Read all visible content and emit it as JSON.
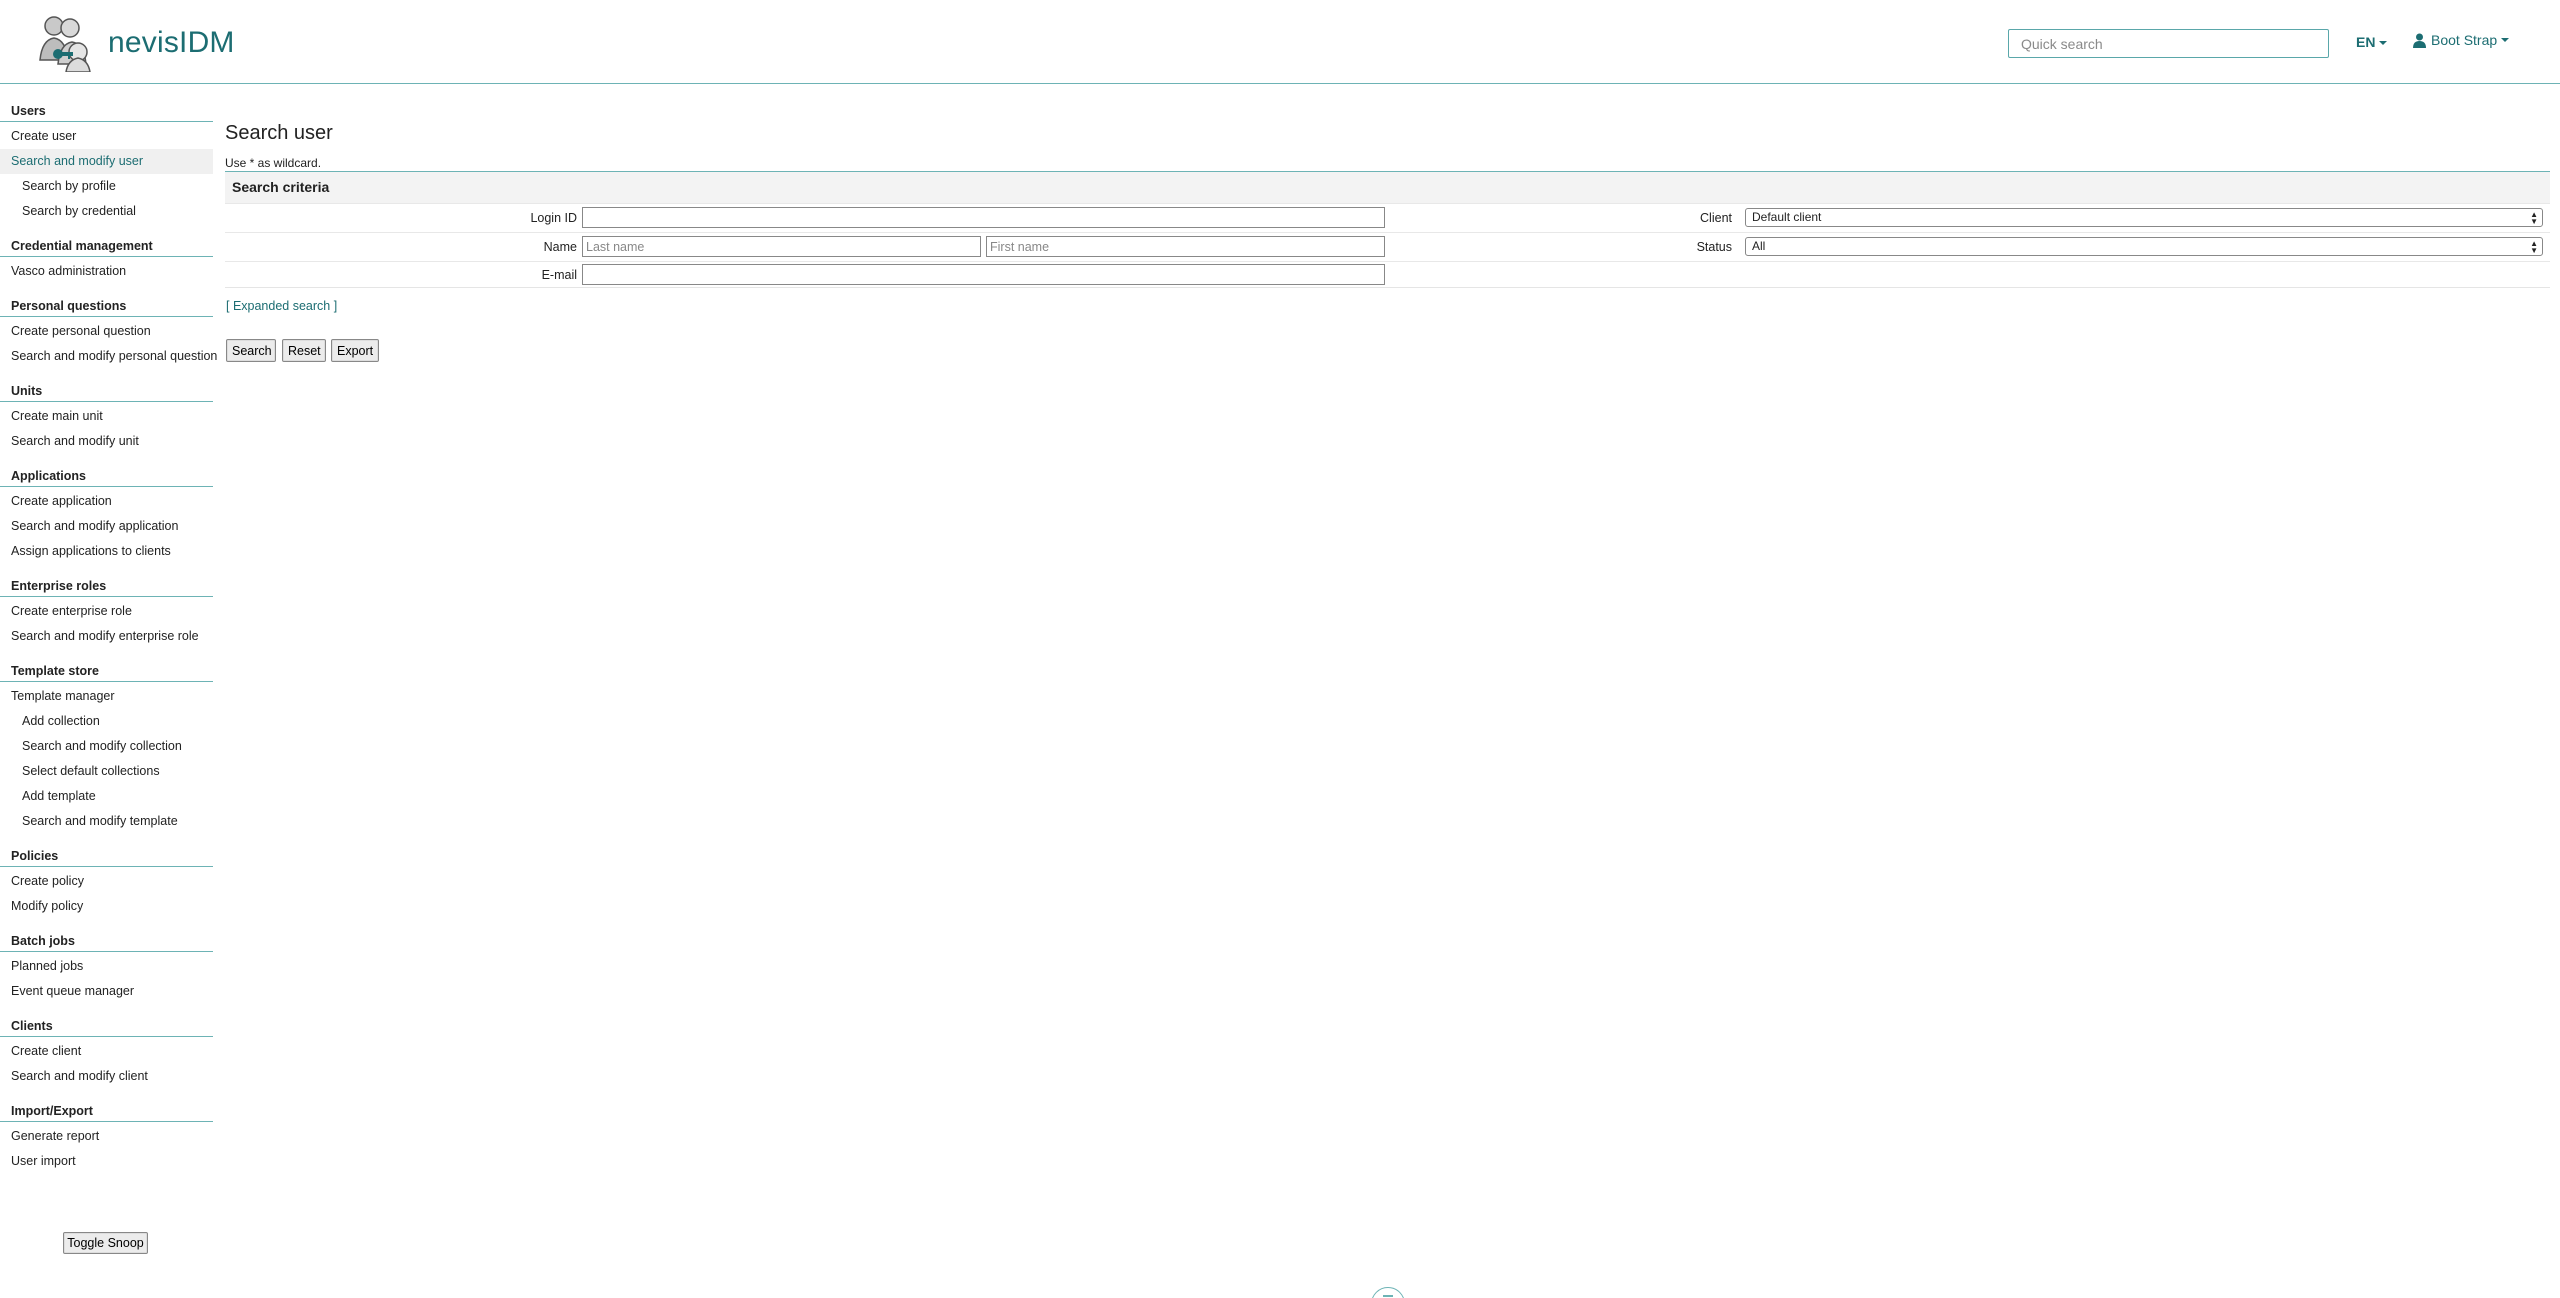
{
  "header": {
    "brand": "nevisIDM",
    "quick_search_placeholder": "Quick search",
    "language": "EN",
    "user_name": "Boot Strap"
  },
  "sidebar": {
    "sections": [
      {
        "title": "Users",
        "items": [
          {
            "label": "Create user"
          },
          {
            "label": "Search and modify user",
            "active": true
          },
          {
            "label": "Search by profile",
            "sub": true
          },
          {
            "label": "Search by credential",
            "sub": true
          }
        ]
      },
      {
        "title": "Credential management",
        "items": [
          {
            "label": "Vasco administration"
          }
        ]
      },
      {
        "title": "Personal questions",
        "items": [
          {
            "label": "Create personal question"
          },
          {
            "label": "Search and modify personal question"
          }
        ]
      },
      {
        "title": "Units",
        "items": [
          {
            "label": "Create main unit"
          },
          {
            "label": "Search and modify unit"
          }
        ]
      },
      {
        "title": "Applications",
        "items": [
          {
            "label": "Create application"
          },
          {
            "label": "Search and modify application"
          },
          {
            "label": "Assign applications to clients"
          }
        ]
      },
      {
        "title": "Enterprise roles",
        "items": [
          {
            "label": "Create enterprise role"
          },
          {
            "label": "Search and modify enterprise role"
          }
        ]
      },
      {
        "title": "Template store",
        "items": [
          {
            "label": "Template manager"
          },
          {
            "label": "Add collection",
            "sub": true
          },
          {
            "label": "Search and modify collection",
            "sub": true
          },
          {
            "label": "Select default collections",
            "sub": true
          },
          {
            "label": "Add template",
            "sub": true
          },
          {
            "label": "Search and modify template",
            "sub": true
          }
        ]
      },
      {
        "title": "Policies",
        "items": [
          {
            "label": "Create policy"
          },
          {
            "label": "Modify policy"
          }
        ]
      },
      {
        "title": "Batch jobs",
        "items": [
          {
            "label": "Planned jobs"
          },
          {
            "label": "Event queue manager"
          }
        ]
      },
      {
        "title": "Clients",
        "items": [
          {
            "label": "Create client"
          },
          {
            "label": "Search and modify client"
          }
        ]
      },
      {
        "title": "Import/Export",
        "items": [
          {
            "label": "Generate report"
          },
          {
            "label": "User import"
          }
        ]
      }
    ],
    "toggle_snoop": "Toggle Snoop"
  },
  "main": {
    "title": "Search user",
    "wildcard_note": "Use * as wildcard.",
    "criteria_title": "Search criteria",
    "fields": {
      "login_id_label": "Login ID",
      "login_id_value": "",
      "name_label": "Name",
      "last_name_placeholder": "Last name",
      "first_name_placeholder": "First name",
      "email_label": "E-mail",
      "email_value": "",
      "client_label": "Client",
      "client_value": "Default client",
      "status_label": "Status",
      "status_value": "All"
    },
    "expanded_search": "[ Expanded search ]",
    "buttons": {
      "search": "Search",
      "reset": "Reset",
      "export": "Export"
    }
  },
  "colors": {
    "accent": "#1c6d72",
    "divider": "#6db3b5"
  }
}
